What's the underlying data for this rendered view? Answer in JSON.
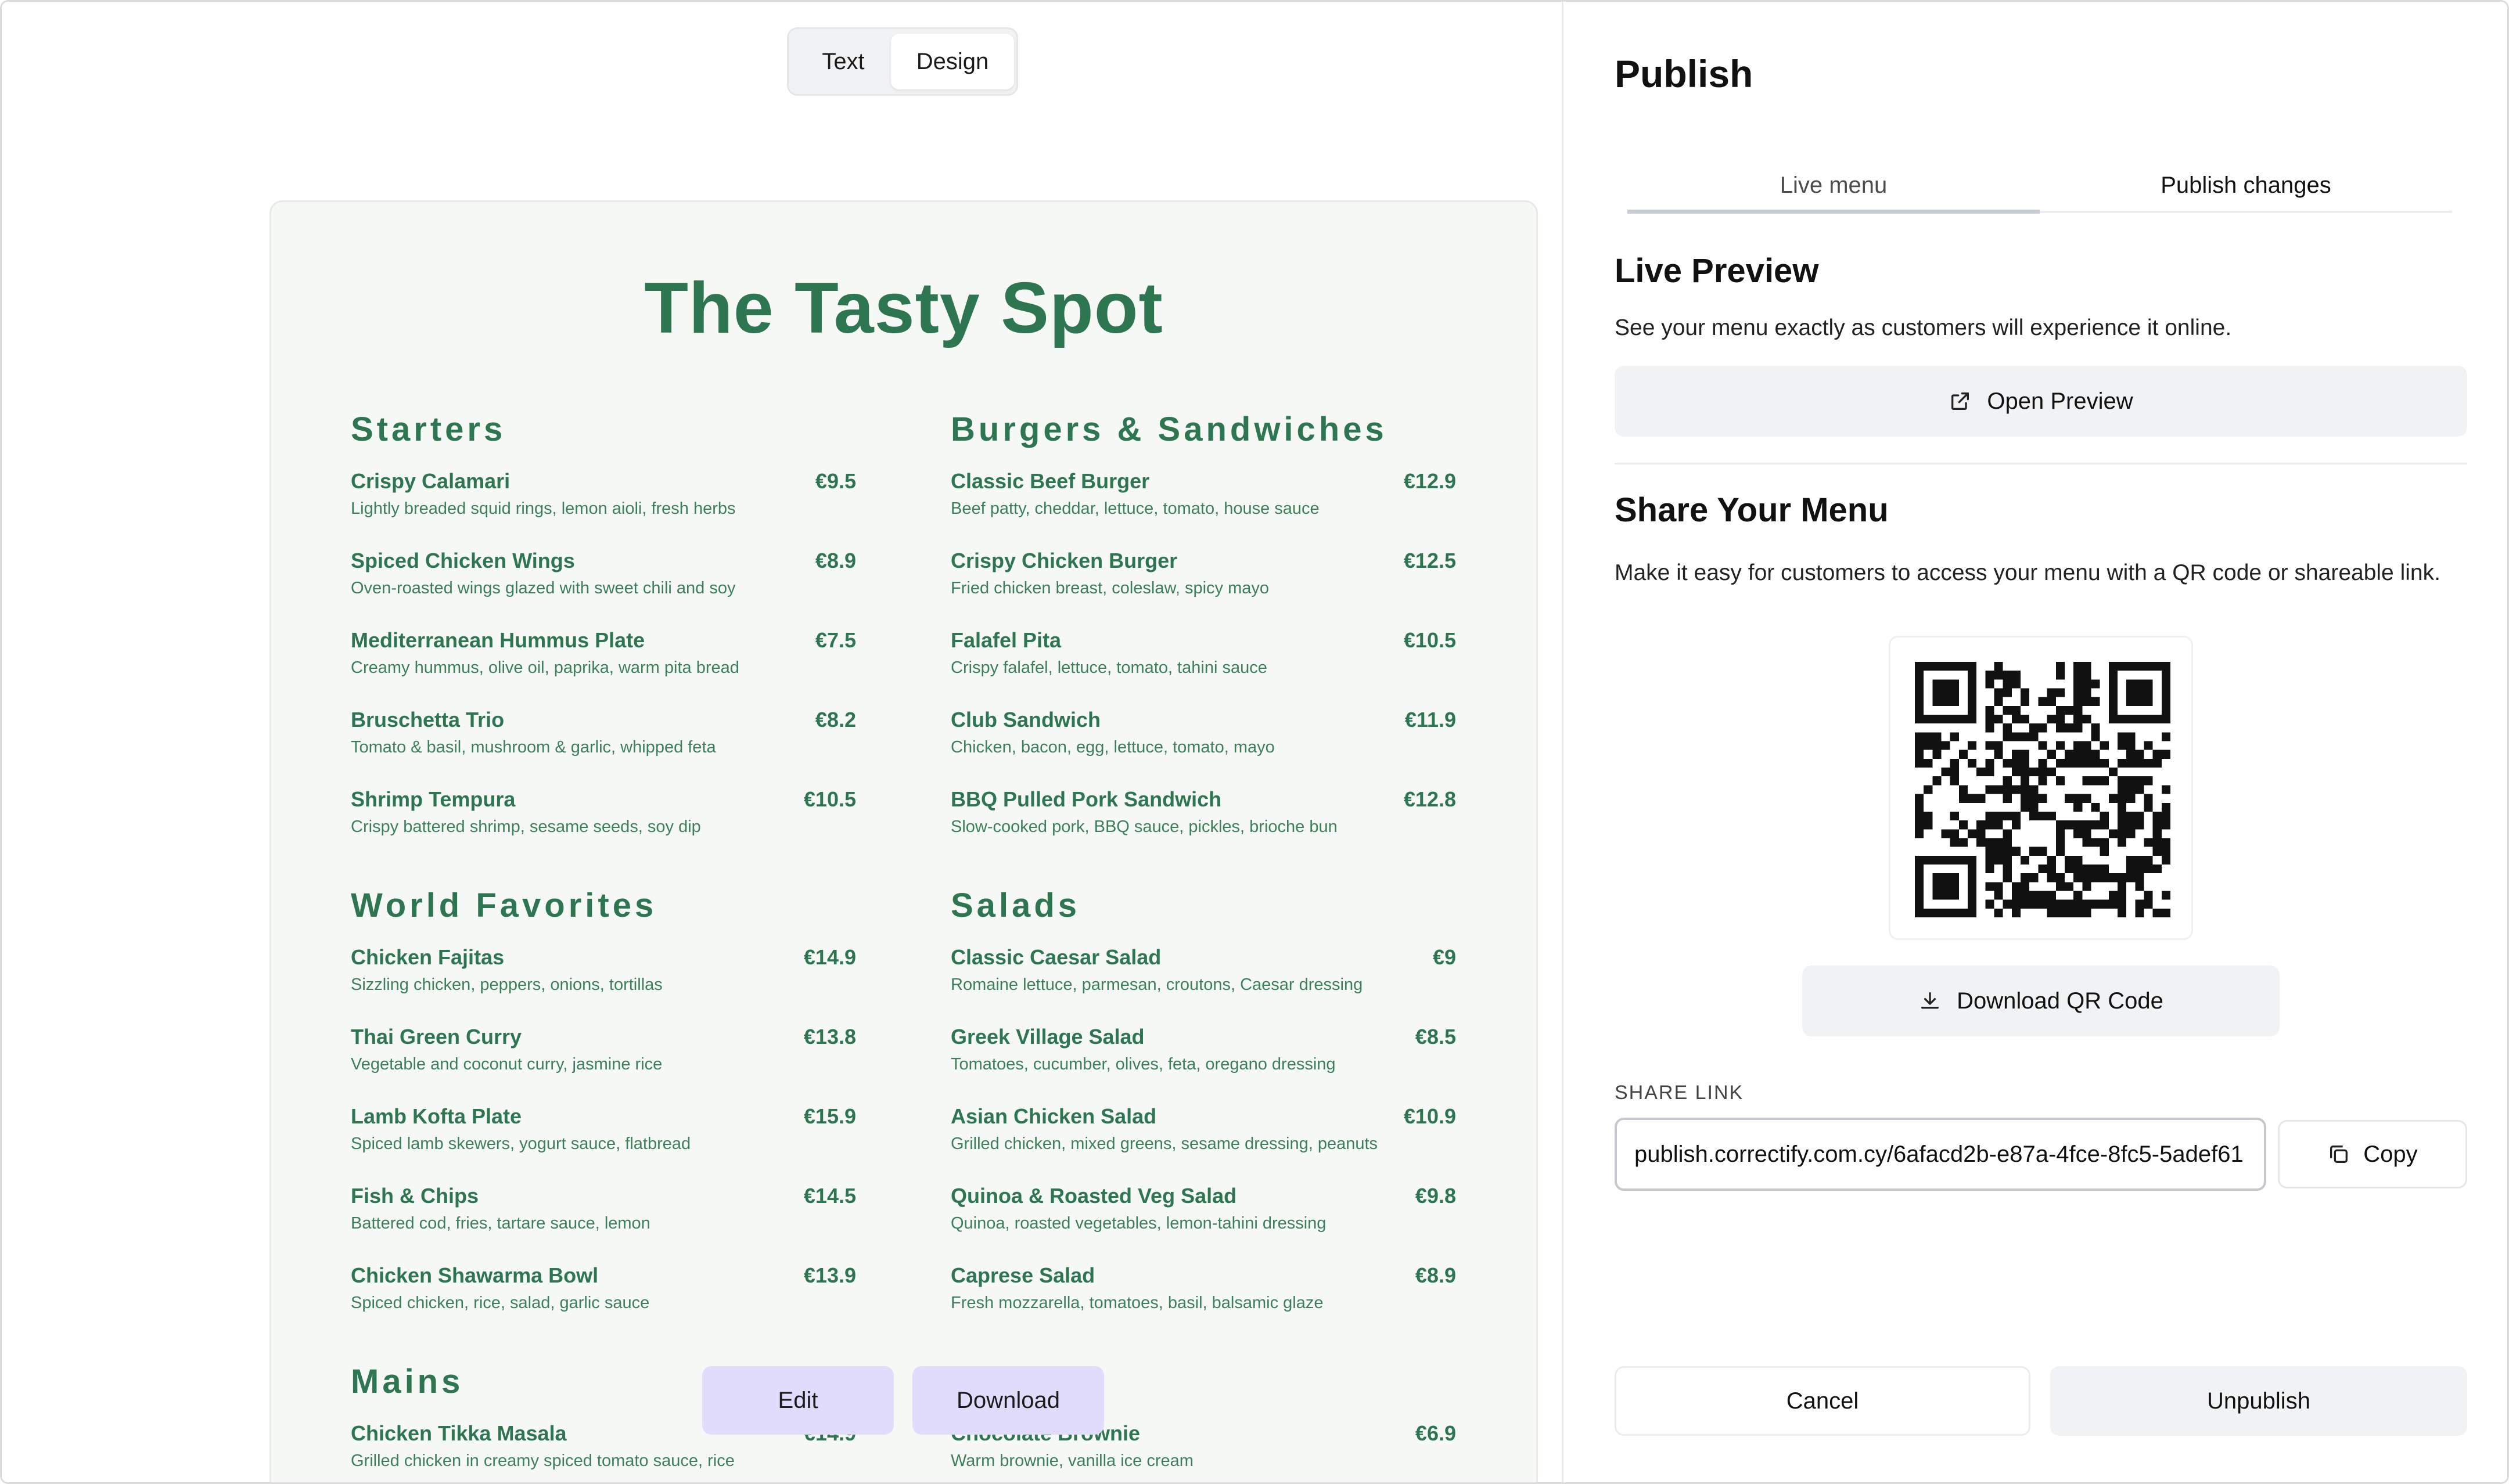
{
  "toggle": {
    "text_label": "Text",
    "design_label": "Design",
    "selected": "Design"
  },
  "menu": {
    "title": "The Tasty Spot",
    "sections": [
      {
        "name": "Starters",
        "items": [
          {
            "name": "Crispy Calamari",
            "price": "€9.5",
            "desc": "Lightly breaded squid rings, lemon aioli, fresh herbs"
          },
          {
            "name": "Spiced Chicken Wings",
            "price": "€8.9",
            "desc": "Oven-roasted wings glazed with sweet chili and soy"
          },
          {
            "name": "Mediterranean Hummus Plate",
            "price": "€7.5",
            "desc": "Creamy hummus, olive oil, paprika, warm pita bread"
          },
          {
            "name": "Bruschetta Trio",
            "price": "€8.2",
            "desc": "Tomato & basil, mushroom & garlic, whipped feta"
          },
          {
            "name": "Shrimp Tempura",
            "price": "€10.5",
            "desc": "Crispy battered shrimp, sesame seeds, soy dip"
          }
        ]
      },
      {
        "name": "Burgers & Sandwiches",
        "items": [
          {
            "name": "Classic Beef Burger",
            "price": "€12.9",
            "desc": "Beef patty, cheddar, lettuce, tomato, house sauce"
          },
          {
            "name": "Crispy Chicken Burger",
            "price": "€12.5",
            "desc": "Fried chicken breast, coleslaw, spicy mayo"
          },
          {
            "name": "Falafel Pita",
            "price": "€10.5",
            "desc": "Crispy falafel, lettuce, tomato, tahini sauce"
          },
          {
            "name": "Club Sandwich",
            "price": "€11.9",
            "desc": "Chicken, bacon, egg, lettuce, tomato, mayo"
          },
          {
            "name": "BBQ Pulled Pork Sandwich",
            "price": "€12.8",
            "desc": "Slow-cooked pork, BBQ sauce, pickles, brioche bun"
          }
        ]
      },
      {
        "name": "World Favorites",
        "items": [
          {
            "name": "Chicken Fajitas",
            "price": "€14.9",
            "desc": "Sizzling chicken, peppers, onions, tortillas"
          },
          {
            "name": "Thai Green Curry",
            "price": "€13.8",
            "desc": "Vegetable and coconut curry, jasmine rice"
          },
          {
            "name": "Lamb Kofta Plate",
            "price": "€15.9",
            "desc": "Spiced lamb skewers, yogurt sauce, flatbread"
          },
          {
            "name": "Fish & Chips",
            "price": "€14.5",
            "desc": "Battered cod, fries, tartare sauce, lemon"
          },
          {
            "name": "Chicken Shawarma Bowl",
            "price": "€13.9",
            "desc": "Spiced chicken, rice, salad, garlic sauce"
          }
        ]
      },
      {
        "name": "Salads",
        "items": [
          {
            "name": "Classic Caesar Salad",
            "price": "€9",
            "desc": "Romaine lettuce, parmesan, croutons, Caesar dressing"
          },
          {
            "name": "Greek Village Salad",
            "price": "€8.5",
            "desc": "Tomatoes, cucumber, olives, feta, oregano dressing"
          },
          {
            "name": "Asian Chicken Salad",
            "price": "€10.9",
            "desc": "Grilled chicken, mixed greens, sesame dressing, peanuts"
          },
          {
            "name": "Quinoa & Roasted Veg Salad",
            "price": "€9.8",
            "desc": "Quinoa, roasted vegetables, lemon-tahini dressing"
          },
          {
            "name": "Caprese Salad",
            "price": "€8.9",
            "desc": "Fresh mozzarella, tomatoes, basil, balsamic glaze"
          }
        ]
      },
      {
        "name": "Mains",
        "items": [
          {
            "name": "Chicken Tikka Masala",
            "price": "€14.9",
            "desc": "Grilled chicken in creamy spiced tomato sauce, rice"
          }
        ]
      },
      {
        "name": "",
        "items": [
          {
            "name": "Chocolate Brownie",
            "price": "€6.9",
            "desc": "Warm brownie, vanilla ice cream"
          }
        ]
      }
    ]
  },
  "floating_actions": {
    "edit_label": "Edit",
    "download_label": "Download"
  },
  "publish_panel": {
    "title": "Publish",
    "tabs": [
      {
        "label": "Live menu"
      },
      {
        "label": "Publish changes"
      }
    ],
    "active_tab": "Live menu",
    "live_preview": {
      "heading": "Live Preview",
      "description": "See your menu exactly as customers will experience it online.",
      "button_label": "Open Preview",
      "button_icon": "external-link-icon"
    },
    "share": {
      "heading": "Share Your Menu",
      "description": "Make it easy for customers to access your menu with a QR code or shareable link.",
      "qr_icon": "qr-code",
      "download_qr_label": "Download QR Code",
      "download_icon": "download-icon",
      "link_label": "SHARE LINK",
      "link_value": "publish.correctify.com.cy/6afacd2b-e87a-4fce-8fc5-5adef61",
      "copy_label": "Copy",
      "copy_icon": "copy-icon"
    },
    "footer": {
      "cancel_label": "Cancel",
      "unpublish_label": "Unpublish"
    }
  },
  "colors": {
    "menu_green": "#2e7551",
    "menu_background": "#f5f8f5",
    "action_purple": "#e2dcfc",
    "button_grey": "#f1f2f4"
  }
}
